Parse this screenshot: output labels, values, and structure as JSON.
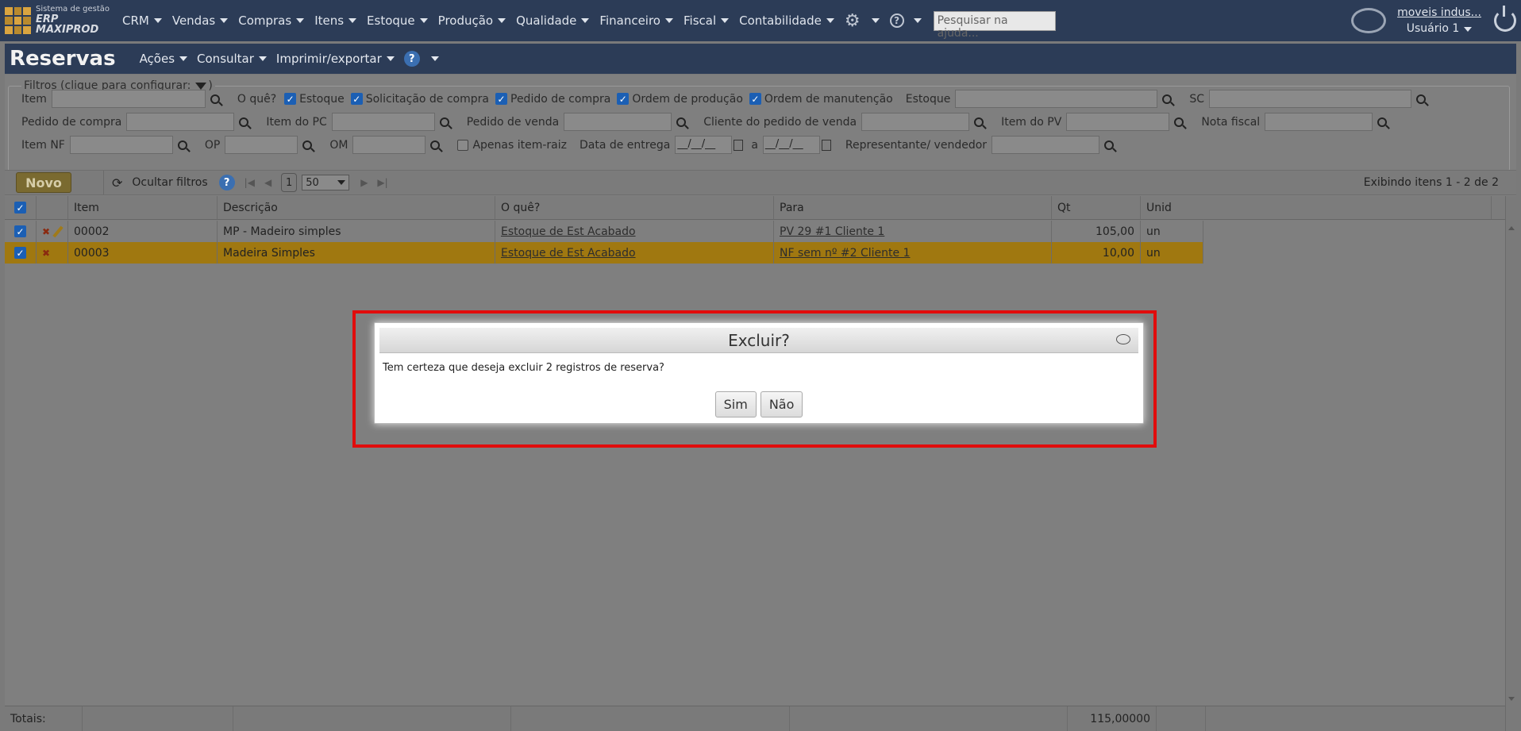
{
  "app": {
    "logo_line1": "Sistema de gestão",
    "logo_line2": "ERP MAXIPROD"
  },
  "nav": {
    "items": [
      "CRM",
      "Vendas",
      "Compras",
      "Itens",
      "Estoque",
      "Produção",
      "Qualidade",
      "Financeiro",
      "Fiscal",
      "Contabilidade"
    ],
    "search_placeholder": "Pesquisar na ajuda..."
  },
  "user": {
    "company": "moveis indus...",
    "name": "Usuário 1"
  },
  "page": {
    "title": "Reservas",
    "menus": [
      "Ações",
      "Consultar",
      "Imprimir/exportar"
    ],
    "help": "?"
  },
  "filters": {
    "legend": "Filtros (clique para configurar:",
    "legend_close": ")",
    "item": "Item",
    "o_que": "O quê?",
    "checks": [
      "Estoque",
      "Solicitação de compra",
      "Pedido de compra",
      "Ordem de produção",
      "Ordem de manutenção"
    ],
    "estoque": "Estoque",
    "sc": "SC",
    "pedido_compra": "Pedido de compra",
    "item_pc": "Item do PC",
    "pedido_venda": "Pedido de venda",
    "cliente_pv": "Cliente do pedido de venda",
    "item_pv": "Item do PV",
    "nota_fiscal": "Nota fiscal",
    "item_nf": "Item NF",
    "op": "OP",
    "om": "OM",
    "apenas_raiz": "Apenas item-raiz",
    "data_entrega": "Data de entrega",
    "date_from": "__/__/__",
    "date_sep": "a",
    "date_to": "__/__/__",
    "representante": "Representante/ vendedor"
  },
  "toolbar": {
    "novo": "Novo",
    "hide_filters": "Ocultar filtros",
    "page": "1",
    "page_size": "50",
    "showing": "Exibindo itens 1 - 2 de 2"
  },
  "grid": {
    "columns": [
      "Item",
      "Descrição",
      "O quê?",
      "Para",
      "Qt",
      "Unid"
    ],
    "rows": [
      {
        "item": "00002",
        "descricao": "MP - Madeiro simples",
        "oque": "Estoque de Est Acabado",
        "para": "PV 29 #1 Cliente 1",
        "qt": "105,00",
        "unid": "un"
      },
      {
        "item": "00003",
        "descricao": "Madeira Simples",
        "oque": "Estoque de Est Acabado",
        "para": "NF sem nº #2 Cliente 1",
        "qt": "10,00",
        "unid": "un"
      }
    ],
    "totals_label": "Totais:",
    "totals_qt": "115,00000"
  },
  "dialog": {
    "title": "Excluir?",
    "message": "Tem certeza que deseja excluir 2 registros de reserva?",
    "yes": "Sim",
    "no": "Não"
  },
  "colors": {
    "highlight": "#e10c0c",
    "nav_bg": "#2c3c57",
    "selected_row": "#a07810"
  }
}
